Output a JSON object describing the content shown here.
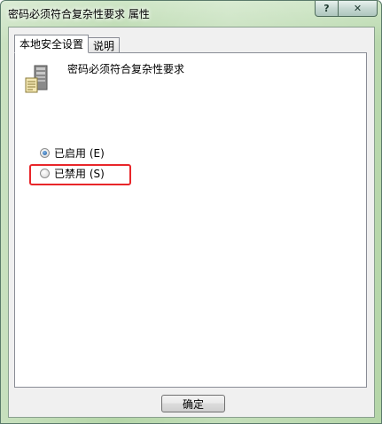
{
  "window": {
    "title": "密码必须符合复杂性要求 属性",
    "help_label": "?",
    "close_label": "✕"
  },
  "tabs": [
    {
      "label": "本地安全设置",
      "active": true
    },
    {
      "label": "说明",
      "active": false
    }
  ],
  "policy": {
    "name": "密码必须符合复杂性要求",
    "icon": "server-policy-icon"
  },
  "options": [
    {
      "label": "已启用 (E)",
      "checked": true
    },
    {
      "label": "已禁用 (S)",
      "checked": false
    }
  ],
  "buttons": {
    "ok_label": "确定"
  },
  "colors": {
    "highlight": "#e8262a",
    "title_bar": "#b9d8ad"
  }
}
